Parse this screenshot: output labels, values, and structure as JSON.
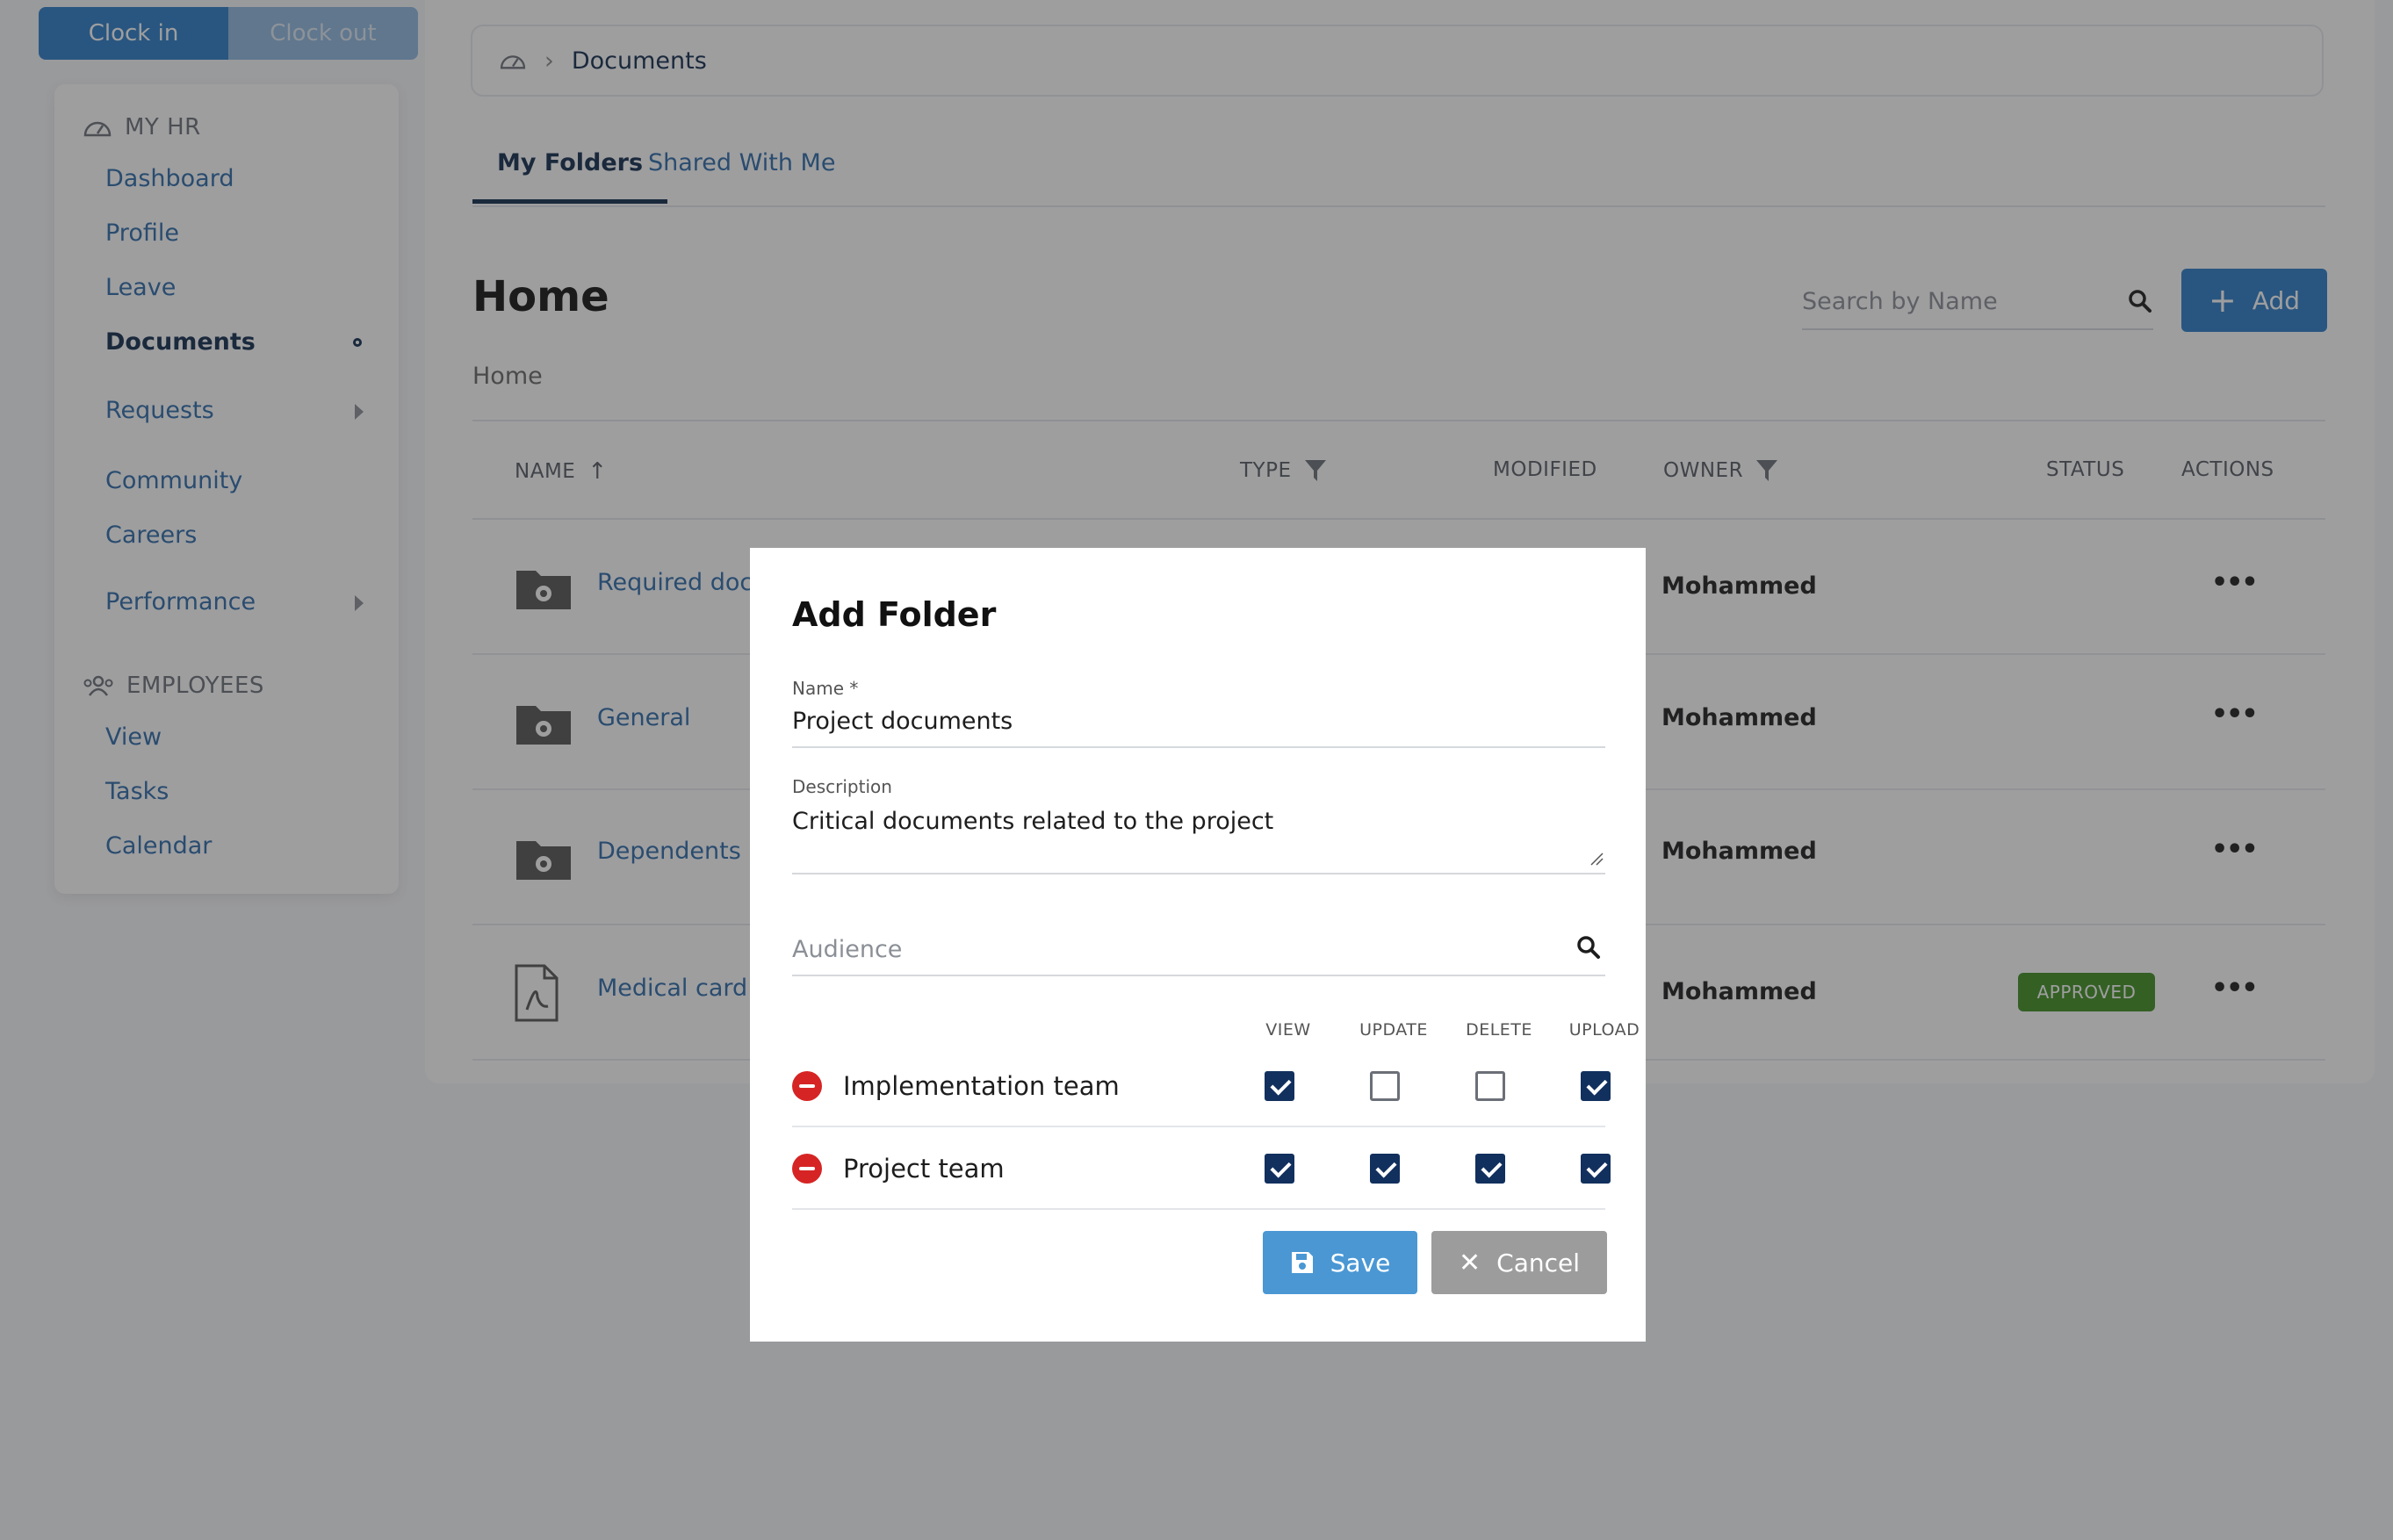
{
  "clock": {
    "in_label": "Clock in",
    "out_label": "Clock out"
  },
  "sidebar": {
    "myhr_title": "MY HR",
    "myhr_items": [
      {
        "label": "Dashboard"
      },
      {
        "label": "Profile"
      },
      {
        "label": "Leave"
      },
      {
        "label": "Documents"
      },
      {
        "label": "Requests"
      },
      {
        "label": "Community"
      },
      {
        "label": "Careers"
      },
      {
        "label": "Performance"
      }
    ],
    "employees_title": "EMPLOYEES",
    "employees_items": [
      {
        "label": "View"
      },
      {
        "label": "Tasks"
      },
      {
        "label": "Calendar"
      }
    ]
  },
  "breadcrumb": {
    "current": "Documents"
  },
  "tabs": [
    {
      "label": "My Folders"
    },
    {
      "label": "Shared With Me"
    }
  ],
  "page": {
    "title": "Home",
    "path": "Home",
    "search_placeholder": "Search by Name",
    "add_label": "Add"
  },
  "table": {
    "headers": {
      "name": "NAME",
      "type": "TYPE",
      "modified": "MODIFIED",
      "owner": "OWNER",
      "status": "STATUS",
      "actions": "ACTIONS"
    },
    "rows": [
      {
        "name": "Required docu",
        "owner": "Mohammed",
        "status": ""
      },
      {
        "name": "General",
        "owner": "Mohammed",
        "status": ""
      },
      {
        "name": "Dependents",
        "owner": "Mohammed",
        "status": ""
      },
      {
        "name": "Medical card -",
        "owner": "Mohammed",
        "status": "APPROVED"
      }
    ],
    "actions_glyph": "•••"
  },
  "modal": {
    "title": "Add Folder",
    "name_label": "Name *",
    "name_value": "Project documents",
    "description_label": "Description",
    "description_value": "Critical documents related to the project",
    "audience_placeholder": "Audience",
    "perm_headers": {
      "view": "VIEW",
      "update": "UPDATE",
      "delete": "DELETE",
      "upload": "UPLOAD"
    },
    "audience": [
      {
        "name": "Implementation team",
        "view": true,
        "update": false,
        "delete": false,
        "upload": true
      },
      {
        "name": "Project team",
        "view": true,
        "update": true,
        "delete": true,
        "upload": true
      }
    ],
    "save_label": "Save",
    "cancel_label": "Cancel"
  },
  "colors": {
    "primary": "#2a7cc7",
    "navy": "#102a4c",
    "approved": "#3e8f1f",
    "remove": "#d62424"
  }
}
